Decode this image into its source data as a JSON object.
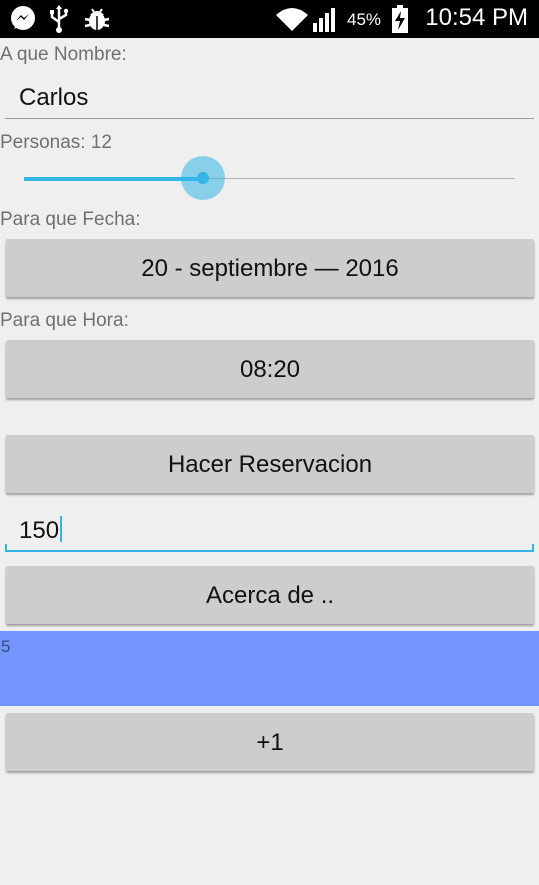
{
  "status_bar": {
    "icons": [
      "messenger-icon",
      "usb-icon",
      "android-debug-icon",
      "wifi-icon",
      "signal-icon",
      "battery-charging-icon"
    ],
    "battery_percent": "45%",
    "time": "10:54 PM"
  },
  "form": {
    "name_label": "A que Nombre:",
    "name_value": "Carlos",
    "persons_label": "Personas: 12",
    "persons_slider_fraction": 0.37,
    "date_label": "Para que Fecha:",
    "date_button": "20 - septiembre — 2016",
    "time_label": "Para que Hora:",
    "time_button": "08:20",
    "reserve_button": "Hacer Reservacion",
    "amount_value": "150",
    "about_button": "Acerca de ..",
    "counter_value": "5",
    "increment_button": "+1"
  },
  "colors": {
    "accent": "#33b5e5",
    "counter_background": "#7395ff",
    "button_background": "#cdcdcd"
  }
}
